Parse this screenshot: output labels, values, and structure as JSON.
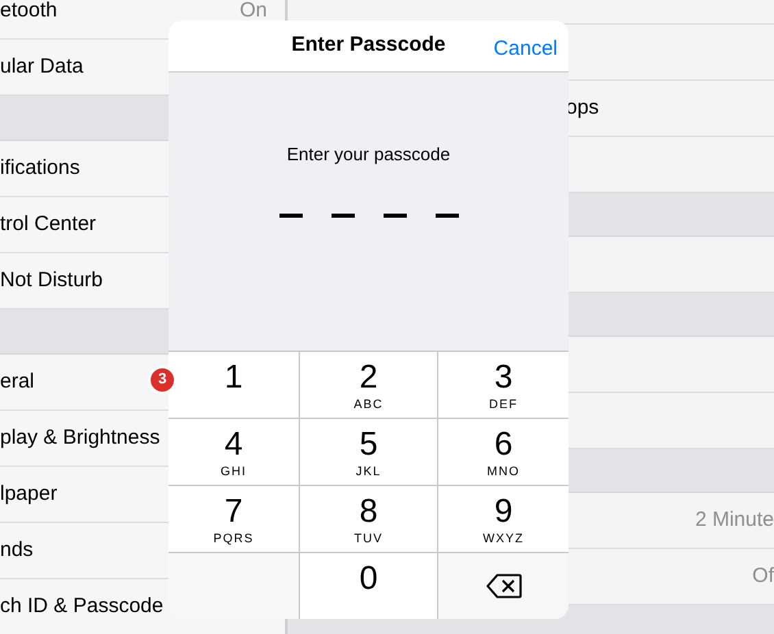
{
  "left_list": [
    {
      "kind": "row",
      "label": "etooth",
      "value": "On"
    },
    {
      "kind": "row",
      "label": "ular Data"
    },
    {
      "kind": "header"
    },
    {
      "kind": "row",
      "label": "ifications"
    },
    {
      "kind": "row",
      "label": "trol Center"
    },
    {
      "kind": "row",
      "label": "Not Disturb"
    },
    {
      "kind": "header"
    },
    {
      "kind": "row",
      "label": "eral",
      "badge": "3"
    },
    {
      "kind": "row",
      "label": "play & Brightness"
    },
    {
      "kind": "row",
      "label": "lpaper"
    },
    {
      "kind": "row",
      "label": "nds"
    },
    {
      "kind": "row",
      "label": "ch ID & Passcode"
    }
  ],
  "right_list": [
    {
      "kind": "row"
    },
    {
      "kind": "row"
    },
    {
      "kind": "row",
      "label": "ops"
    },
    {
      "kind": "row"
    },
    {
      "kind": "header"
    },
    {
      "kind": "row"
    },
    {
      "kind": "header"
    },
    {
      "kind": "row"
    },
    {
      "kind": "row"
    },
    {
      "kind": "header"
    },
    {
      "kind": "row",
      "value": "2 Minute"
    },
    {
      "kind": "row",
      "value": "Of"
    },
    {
      "kind": "header"
    }
  ],
  "dialog": {
    "title": "Enter Passcode",
    "cancel": "Cancel",
    "prompt": "Enter your passcode",
    "slots": [
      {
        "filled": false
      },
      {
        "filled": false
      },
      {
        "filled": false
      },
      {
        "filled": false
      }
    ],
    "keys": [
      {
        "kind": "digit",
        "digit": "1"
      },
      {
        "kind": "digit",
        "digit": "2",
        "letters": "ABC"
      },
      {
        "kind": "digit",
        "digit": "3",
        "letters": "DEF"
      },
      {
        "kind": "digit",
        "digit": "4",
        "letters": "GHI"
      },
      {
        "kind": "digit",
        "digit": "5",
        "letters": "JKL"
      },
      {
        "kind": "digit",
        "digit": "6",
        "letters": "MNO"
      },
      {
        "kind": "digit",
        "digit": "7",
        "letters": "PQRS"
      },
      {
        "kind": "digit",
        "digit": "8",
        "letters": "TUV"
      },
      {
        "kind": "digit",
        "digit": "9",
        "letters": "WXYZ"
      },
      {
        "kind": "blank"
      },
      {
        "kind": "digit",
        "digit": "0"
      },
      {
        "kind": "delete"
      }
    ]
  }
}
